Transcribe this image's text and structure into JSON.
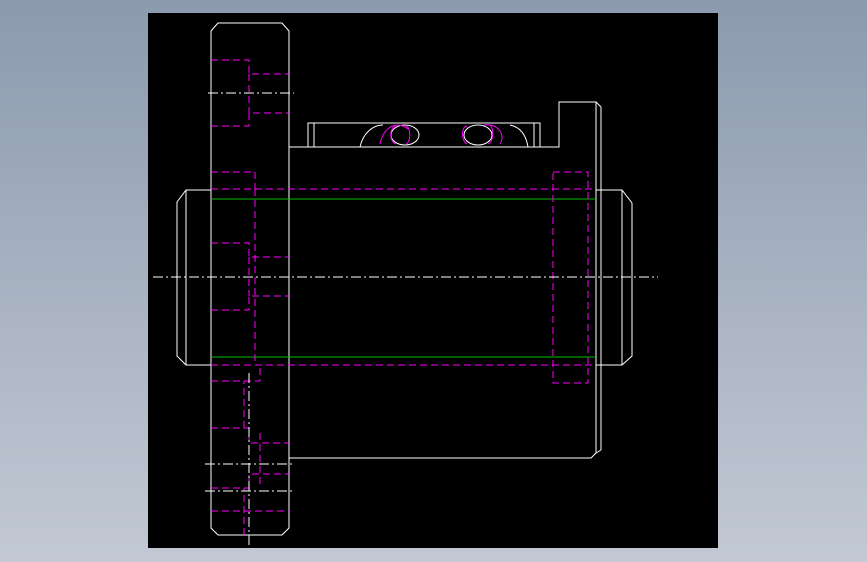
{
  "canvas": {
    "background_color": "#000000",
    "page_background": "#98a5b6"
  },
  "colors": {
    "visible_line": "#ffffff",
    "hidden_line": "#ff00ff",
    "thread_line": "#00c000",
    "center_line": "#ffffff"
  },
  "drawing": {
    "type": "cad-2d-section-view",
    "subject": "ball-screw-nut-with-flange"
  }
}
